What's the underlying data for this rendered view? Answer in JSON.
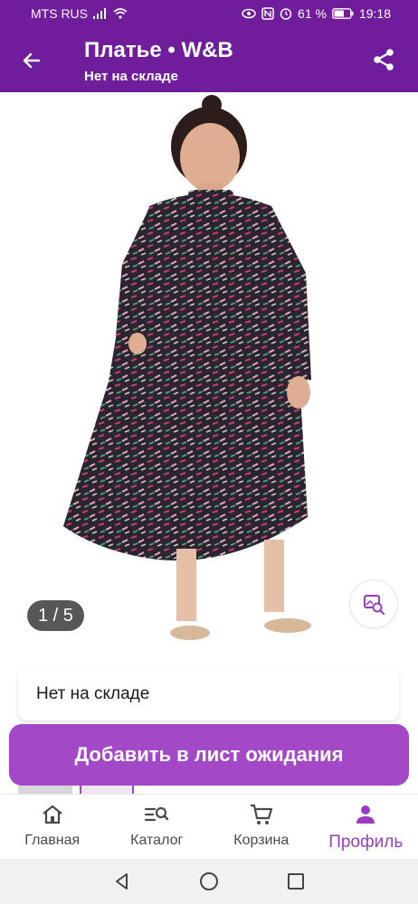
{
  "status_bar": {
    "carrier": "MTS RUS",
    "battery": "61 %",
    "time": "19:18"
  },
  "app_bar": {
    "title": "Платье • W&B",
    "subtitle": "Нет на складе"
  },
  "gallery": {
    "counter": "1 / 5"
  },
  "stock": {
    "label": "Нет на складе"
  },
  "actions": {
    "waitlist_label": "Добавить в лист ожидания"
  },
  "bottom_nav": {
    "items": [
      {
        "label": "Главная",
        "icon": "home-icon"
      },
      {
        "label": "Каталог",
        "icon": "catalog-search-icon"
      },
      {
        "label": "Корзина",
        "icon": "cart-icon"
      },
      {
        "label": "Профиль",
        "icon": "profile-icon"
      }
    ],
    "active_index": 3
  },
  "colors": {
    "brand_purple": "#6f1d9a",
    "button_purple": "#a348c7",
    "active_nav": "#9b3bc2"
  }
}
